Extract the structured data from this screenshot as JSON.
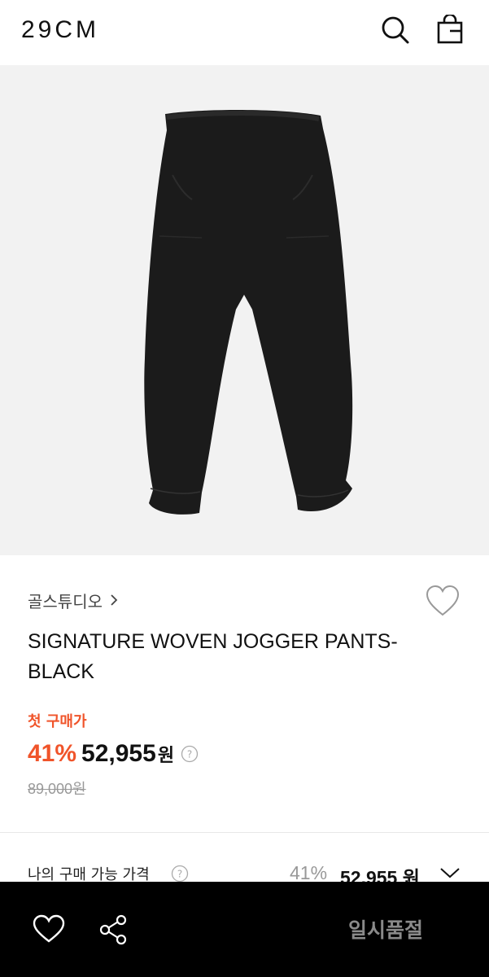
{
  "header": {
    "logo": "29CM",
    "icons": [
      "search-icon",
      "shopping-bag-icon"
    ]
  },
  "product": {
    "brand": "골스튜디오",
    "title": "SIGNATURE WOVEN JOGGER PANTS-BLACK",
    "first_purchase_label": "첫 구매가",
    "discount": "41%",
    "price": "52,955",
    "currency": "원",
    "original_price": "89,000원"
  },
  "my_price": {
    "label": "나의 구매 가능 가격",
    "discount": "41%",
    "price": "52,955 원"
  },
  "bottom_bar": {
    "status": "일시품절",
    "icons": [
      "heart-icon",
      "share-icon"
    ]
  },
  "colors": {
    "accent": "#f0542a",
    "hero_bg": "#f2f2f2",
    "bottom_bar_bg": "#000000",
    "soldout_text": "#8a8a8a"
  }
}
